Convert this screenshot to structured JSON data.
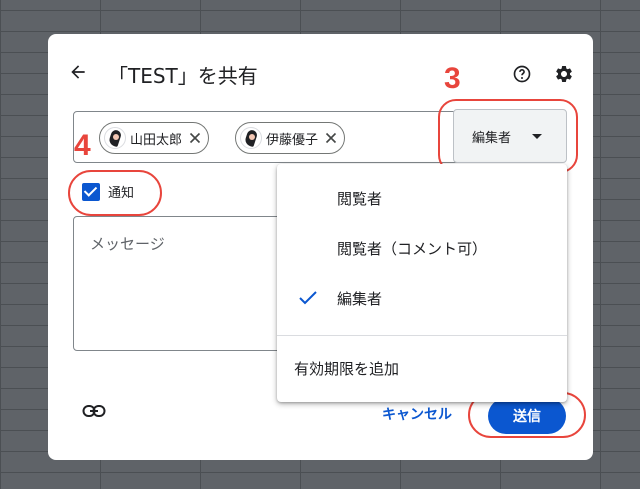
{
  "dialog": {
    "title": "「TEST」を共有",
    "role_button_label": "編集者",
    "recipients": [
      {
        "name": "山田太郎"
      },
      {
        "name": "伊藤優子"
      }
    ],
    "notify_label": "通知",
    "notify_checked": true,
    "message_placeholder": "メッセージ",
    "cancel_label": "キャンセル",
    "send_label": "送信"
  },
  "role_menu": {
    "items": [
      {
        "label": "閲覧者",
        "selected": false
      },
      {
        "label": "閲覧者（コメント可）",
        "selected": false
      },
      {
        "label": "編集者",
        "selected": true
      }
    ],
    "expiry_label": "有効期限を追加"
  },
  "annotations": {
    "step_3": "3",
    "step_4": "4",
    "color": "#e8453c"
  },
  "colors": {
    "primary": "#0b57d0",
    "background_overlay": "#5f6368"
  }
}
